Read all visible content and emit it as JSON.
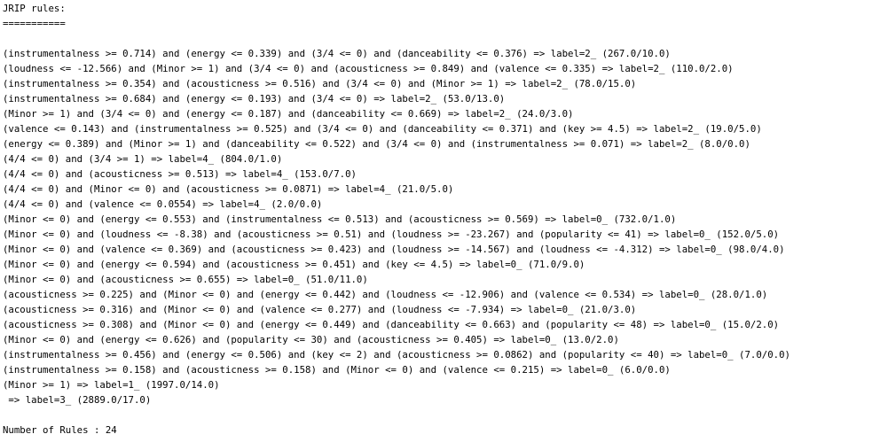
{
  "header": {
    "title": "JRIP rules:",
    "underline": "==========="
  },
  "rules": [
    "(instrumentalness >= 0.714) and (energy <= 0.339) and (3/4 <= 0) and (danceability <= 0.376) => label=2_ (267.0/10.0)",
    "(loudness <= -12.566) and (Minor >= 1) and (3/4 <= 0) and (acousticness >= 0.849) and (valence <= 0.335) => label=2_ (110.0/2.0)",
    "(instrumentalness >= 0.354) and (acousticness >= 0.516) and (3/4 <= 0) and (Minor >= 1) => label=2_ (78.0/15.0)",
    "(instrumentalness >= 0.684) and (energy <= 0.193) and (3/4 <= 0) => label=2_ (53.0/13.0)",
    "(Minor >= 1) and (3/4 <= 0) and (energy <= 0.187) and (danceability <= 0.669) => label=2_ (24.0/3.0)",
    "(valence <= 0.143) and (instrumentalness >= 0.525) and (3/4 <= 0) and (danceability <= 0.371) and (key >= 4.5) => label=2_ (19.0/5.0)",
    "(energy <= 0.389) and (Minor >= 1) and (danceability <= 0.522) and (3/4 <= 0) and (instrumentalness >= 0.071) => label=2_ (8.0/0.0)",
    "(4/4 <= 0) and (3/4 >= 1) => label=4_ (804.0/1.0)",
    "(4/4 <= 0) and (acousticness >= 0.513) => label=4_ (153.0/7.0)",
    "(4/4 <= 0) and (Minor <= 0) and (acousticness >= 0.0871) => label=4_ (21.0/5.0)",
    "(4/4 <= 0) and (valence <= 0.0554) => label=4_ (2.0/0.0)",
    "(Minor <= 0) and (energy <= 0.553) and (instrumentalness <= 0.513) and (acousticness >= 0.569) => label=0_ (732.0/1.0)",
    "(Minor <= 0) and (loudness <= -8.38) and (acousticness >= 0.51) and (loudness >= -23.267) and (popularity <= 41) => label=0_ (152.0/5.0)",
    "(Minor <= 0) and (valence <= 0.369) and (acousticness >= 0.423) and (loudness >= -14.567) and (loudness <= -4.312) => label=0_ (98.0/4.0)",
    "(Minor <= 0) and (energy <= 0.594) and (acousticness >= 0.451) and (key <= 4.5) => label=0_ (71.0/9.0)",
    "(Minor <= 0) and (acousticness >= 0.655) => label=0_ (51.0/11.0)",
    "(acousticness >= 0.225) and (Minor <= 0) and (energy <= 0.442) and (loudness <= -12.906) and (valence <= 0.534) => label=0_ (28.0/1.0)",
    "(acousticness >= 0.316) and (Minor <= 0) and (valence <= 0.277) and (loudness <= -7.934) => label=0_ (21.0/3.0)",
    "(acousticness >= 0.308) and (Minor <= 0) and (energy <= 0.449) and (danceability <= 0.663) and (popularity <= 48) => label=0_ (15.0/2.0)",
    "(Minor <= 0) and (energy <= 0.626) and (popularity <= 30) and (acousticness >= 0.405) => label=0_ (13.0/2.0)",
    "(instrumentalness >= 0.456) and (energy <= 0.506) and (key <= 2) and (acousticness >= 0.0862) and (popularity <= 40) => label=0_ (7.0/0.0)",
    "(instrumentalness >= 0.158) and (acousticness >= 0.158) and (Minor <= 0) and (valence <= 0.215) => label=0_ (6.0/0.0)",
    "(Minor >= 1) => label=1_ (1997.0/14.0)",
    " => label=3_ (2889.0/17.0)"
  ],
  "footer": {
    "summary": "Number of Rules : 24"
  }
}
